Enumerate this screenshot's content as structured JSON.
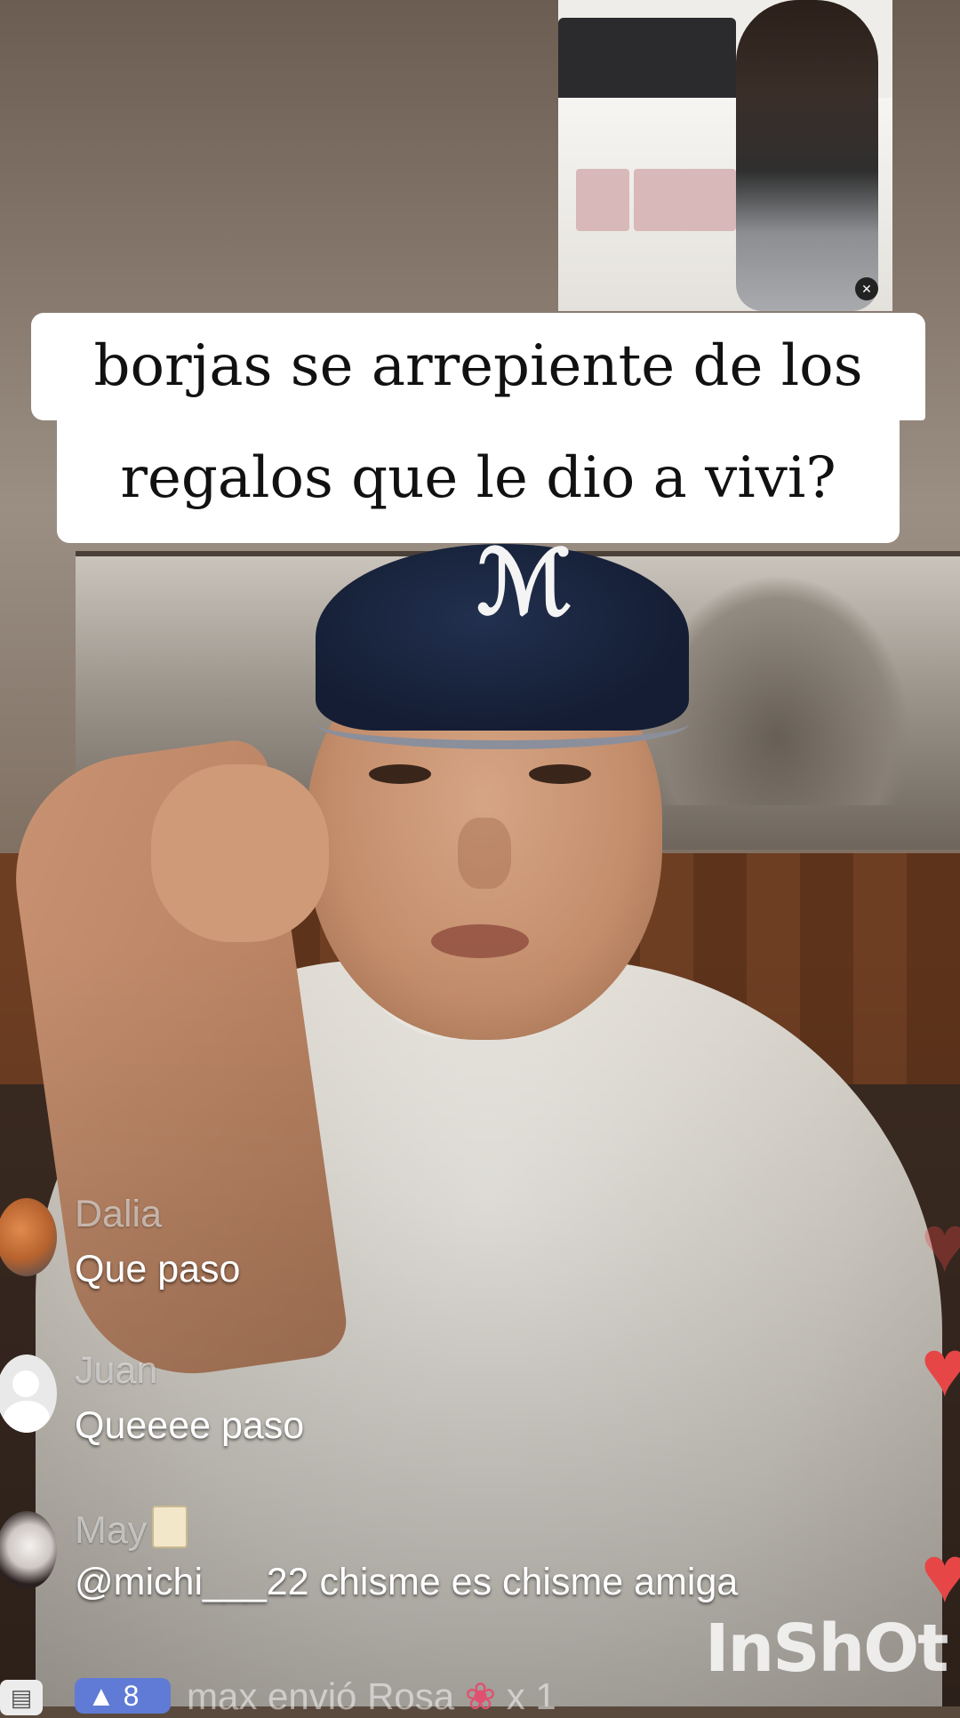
{
  "caption": {
    "line1": "borjas se arrepiente de los",
    "line2": "regalos que le dio a vivi?"
  },
  "inset": {
    "mute_icon": "mute-icon"
  },
  "comments": [
    {
      "username": "Dalia",
      "text": "Que paso"
    },
    {
      "username": "Juan",
      "text": "Queeee paso"
    },
    {
      "username": "May",
      "text": "@michi___22 chisme es chisme amiga"
    }
  ],
  "watermark": "InShOt",
  "gift_bar": {
    "level": "8",
    "text": "max envió Rosa",
    "count": "x 1"
  },
  "colors": {
    "heart": "#e64646",
    "level_pill": "#5f7bd6"
  }
}
